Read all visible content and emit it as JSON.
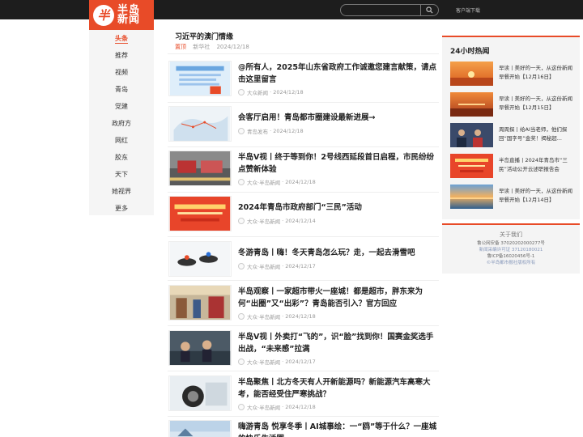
{
  "header": {
    "logo_mark": "半",
    "logo_text": "半岛新闻",
    "client_download": "客户端下载"
  },
  "nav": {
    "items": [
      {
        "label": "头条",
        "active": true
      },
      {
        "label": "推荐"
      },
      {
        "label": "视频"
      },
      {
        "label": "青岛"
      },
      {
        "label": "党建"
      },
      {
        "label": "政府方"
      },
      {
        "label": "网红"
      },
      {
        "label": "胶东"
      },
      {
        "label": "天下"
      },
      {
        "label": "她视界"
      },
      {
        "label": "更多"
      }
    ]
  },
  "featured": {
    "title": "习近平的澳门情缘",
    "tag": "置顶",
    "source": "新华社",
    "date": "2024/12/18"
  },
  "articles": [
    {
      "title": "@所有人，2025年山东省政府工作诚邀您建言献策，请点击这里留言",
      "source": "大众新闻",
      "date": "2024/12/18"
    },
    {
      "title": "会客厅启用！青岛都市圈建设最新进展→",
      "source": "青岛发布",
      "date": "2024/12/18"
    },
    {
      "title": "半岛V视丨终于等到你！2号线西延段首日启程，市民纷纷点赞新体验",
      "source": "大众·半岛新闻",
      "date": "2024/12/18"
    },
    {
      "title": "2024年青岛市政府部门“三民”活动",
      "source": "大众·半岛新闻",
      "date": "2024/12/14"
    },
    {
      "title": "冬游青岛丨嗨！冬天青岛怎么玩？走，一起去滑雪吧",
      "source": "大众·半岛新闻",
      "date": "2024/12/17"
    },
    {
      "title": "半岛观察丨一家超市带火一座城！都是超市，胖东来为何“出圈”又“出彩”？青岛能否引入？官方回应",
      "source": "大众·半岛新闻",
      "date": "2024/12/18"
    },
    {
      "title": "半岛V视丨外卖打“飞的”，识“脸”找到你！国赛金奖选手出战，“未来感”拉满",
      "source": "大众·半岛新闻",
      "date": "2024/12/17"
    },
    {
      "title": "半岛聚焦丨北方冬天有人开新能源吗？新能源汽车高寒大考，能否经受住严寒挑战？",
      "source": "大众·半岛新闻",
      "date": "2024/12/18"
    },
    {
      "title": "嗨游青岛 悦享冬季丨AI城事绘：一“鸥”等于什么？一座城的快乐生活圈",
      "source": "",
      "date": ""
    }
  ],
  "hot": {
    "title": "24小时热闻",
    "items": [
      {
        "text": "早读丨美好的一天，从这份新闻早餐开始【12月16日】"
      },
      {
        "text": "早读丨美好的一天，从这份新闻早餐开始【12月15日】"
      },
      {
        "text": "周周探丨给AI当老师，他们探回“国字号”金奖！揭秘超..."
      },
      {
        "text": "半岛直播丨2024年青岛市“三民”活动公开云述职报告会"
      },
      {
        "text": "早读丨美好的一天，从这份新闻早餐开始【12月14日】"
      }
    ]
  },
  "about": {
    "title": "关于我们",
    "lines": [
      "鲁公网安备 37020202000277号",
      "新闻采编许可证 37120180021",
      "鲁ICP备16020456号-1",
      "©半岛都市报社版权所有"
    ]
  }
}
